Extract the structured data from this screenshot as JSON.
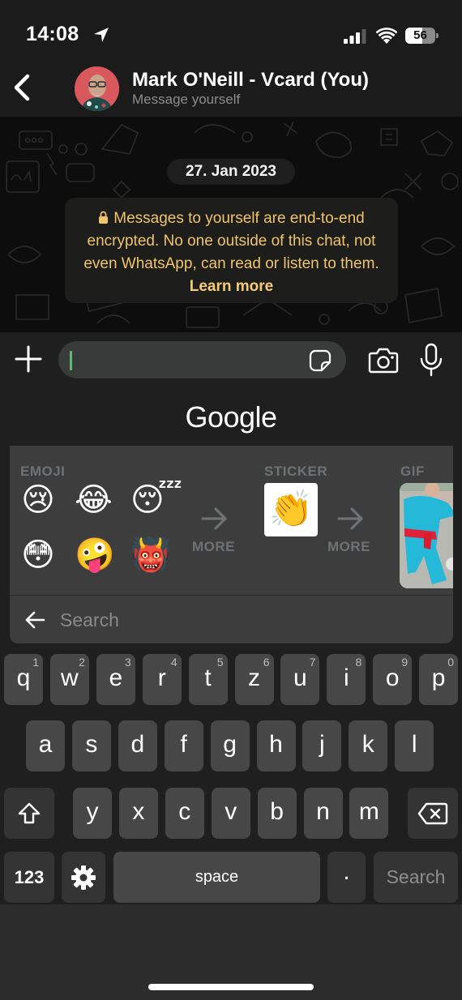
{
  "status_bar": {
    "time": "14:08",
    "battery_percent": 56,
    "battery_text": "56"
  },
  "header": {
    "contact_name": "Mark O'Neill - Vcard (You)",
    "subtitle": "Message yourself"
  },
  "chat": {
    "date_label": "27. Jan 2023",
    "encryption_notice": "Messages to yourself are end-to-end encrypted. No one outside of this chat, not even WhatsApp, can read or listen to them.",
    "learn_more": "Learn more"
  },
  "input": {
    "value": "",
    "placeholder": ""
  },
  "keyboard": {
    "brand": "Google",
    "suggestions": {
      "emoji_label": "EMOJI",
      "emojis": [
        "😢",
        "😂",
        "😴",
        "😳",
        "🤪",
        "👹"
      ],
      "emoji_more": "MORE",
      "sticker_label": "STICKER",
      "sticker": "👏",
      "sticker_more": "MORE",
      "gif_label": "GIF"
    },
    "search": {
      "placeholder": "Search",
      "value": ""
    },
    "rows": [
      [
        {
          "k": "q",
          "h": "1"
        },
        {
          "k": "w",
          "h": "2"
        },
        {
          "k": "e",
          "h": "3"
        },
        {
          "k": "r",
          "h": "4"
        },
        {
          "k": "t",
          "h": "5"
        },
        {
          "k": "z",
          "h": "6"
        },
        {
          "k": "u",
          "h": "7"
        },
        {
          "k": "i",
          "h": "8"
        },
        {
          "k": "o",
          "h": "9"
        },
        {
          "k": "p",
          "h": "0"
        }
      ],
      [
        {
          "k": "a"
        },
        {
          "k": "s"
        },
        {
          "k": "d"
        },
        {
          "k": "f"
        },
        {
          "k": "g"
        },
        {
          "k": "h"
        },
        {
          "k": "j"
        },
        {
          "k": "k"
        },
        {
          "k": "l"
        }
      ],
      [
        {
          "k": "y"
        },
        {
          "k": "x"
        },
        {
          "k": "c"
        },
        {
          "k": "v"
        },
        {
          "k": "b"
        },
        {
          "k": "n"
        },
        {
          "k": "m"
        }
      ]
    ],
    "numbers_key": "123",
    "space_key": "space",
    "period_key": ".",
    "action_key": "Search"
  }
}
